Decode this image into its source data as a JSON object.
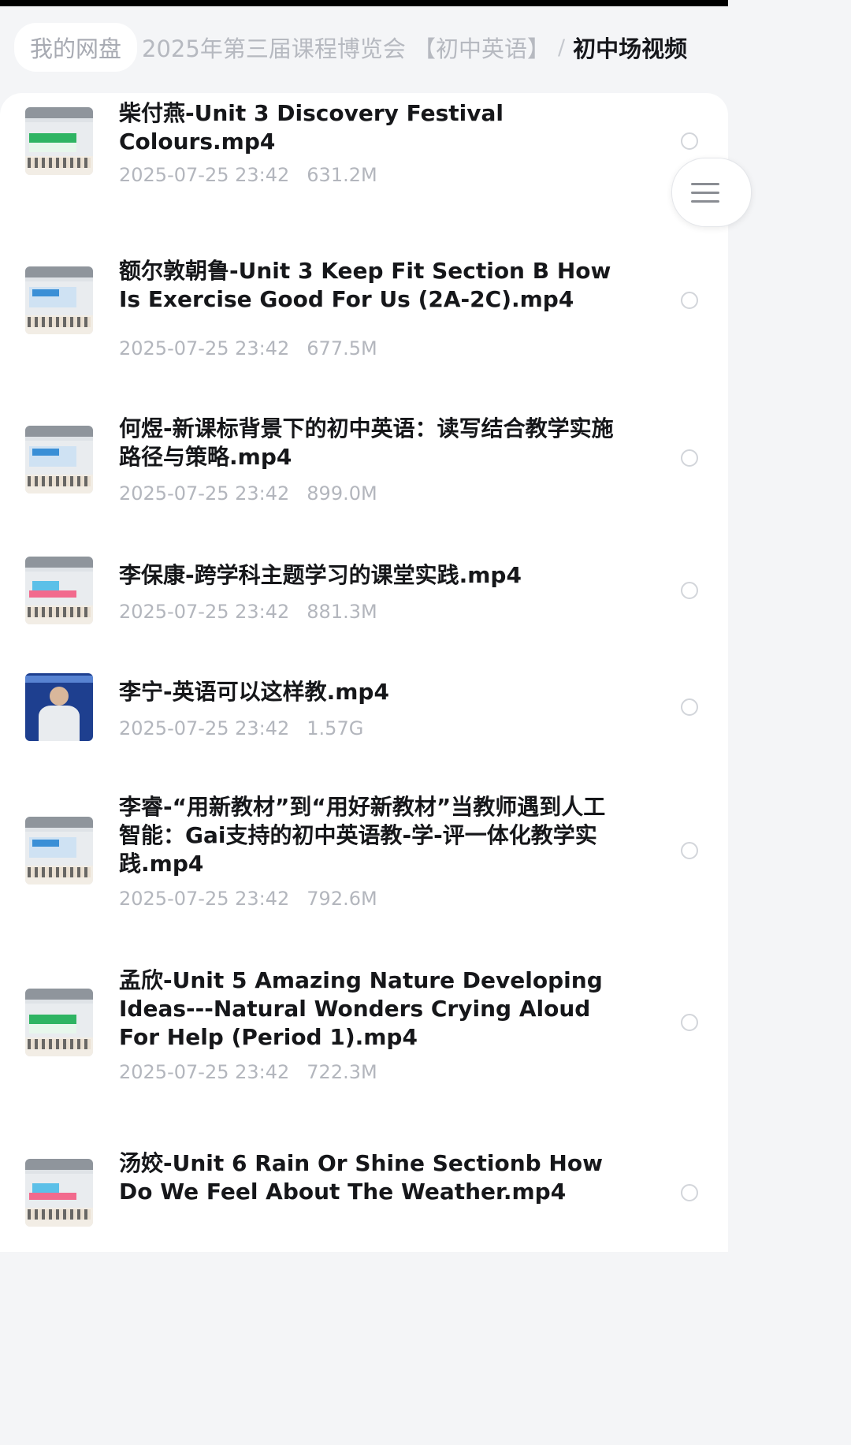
{
  "breadcrumb": {
    "root": "我的网盘",
    "middle": "2025年第三届课程博览会 【初中英语】",
    "separator": "/",
    "current": "初中场视频"
  },
  "menu_button": {
    "icon": "hamburger-menu-icon"
  },
  "files": [
    {
      "title": "柴付燕-Unit 3 Discovery Festival Colours.mp4",
      "date": "2025-07-25 23:42",
      "size": "631.2M",
      "thumbnail": "video-thumbnail"
    },
    {
      "title": "额尔敦朝鲁-Unit 3 Keep Fit Section B How Is Exercise Good For Us (2A-2C).mp4",
      "date": "2025-07-25 23:42",
      "size": "677.5M",
      "thumbnail": "video-thumbnail"
    },
    {
      "title": "何煜-新课标背景下的初中英语：读写结合教学实施路径与策略.mp4",
      "date": "2025-07-25 23:42",
      "size": "899.0M",
      "thumbnail": "video-thumbnail"
    },
    {
      "title": "李保康-跨学科主题学习的课堂实践.mp4",
      "date": "2025-07-25 23:42",
      "size": "881.3M",
      "thumbnail": "video-thumbnail"
    },
    {
      "title": "李宁-英语可以这样教.mp4",
      "date": "2025-07-25 23:42",
      "size": "1.57G",
      "thumbnail": "video-thumbnail"
    },
    {
      "title": "李睿-“用新教材”到“用好新教材”当教师遇到人工智能：Gai支持的初中英语教-学-评一体化教学实践.mp4",
      "date": "2025-07-25 23:42",
      "size": "792.6M",
      "thumbnail": "video-thumbnail"
    },
    {
      "title": "孟欣-Unit 5 Amazing Nature Developing Ideas---Natural Wonders Crying Aloud For Help (Period 1).mp4",
      "date": "2025-07-25 23:42",
      "size": "722.3M",
      "thumbnail": "video-thumbnail"
    },
    {
      "title": "汤姣-Unit 6 Rain Or Shine Sectionb How Do We Feel About The Weather.mp4",
      "date": "",
      "size": "",
      "thumbnail": "video-thumbnail"
    }
  ]
}
